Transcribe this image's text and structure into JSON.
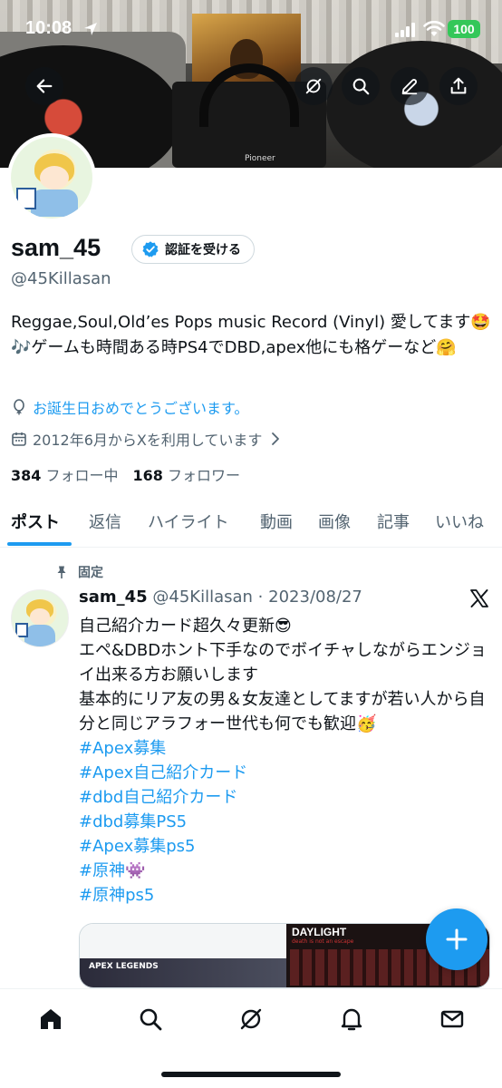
{
  "status_bar": {
    "time": "10:08",
    "battery": "100"
  },
  "banner": {
    "mixer_brand": "Pioneer"
  },
  "header_buttons": {
    "back": "arrow-left-icon",
    "grok": "grok-icon",
    "search": "search-icon",
    "edit": "edit-icon",
    "share": "share-icon"
  },
  "profile": {
    "display_name": "sam_45",
    "verify_label": "認証を受ける",
    "handle": "@45Killasan",
    "bio": "Reggae,Soul,Old’es Pops music Record (Vinyl) 愛してます🤩🎶ゲームも時間ある時PS4でDBD,apex他にも格ゲーなど🤗",
    "birthday_text": "お誕生日おめでとうございます。",
    "joined_text": "2012年6月からXを利用しています",
    "following_count": "384",
    "following_label": "フォロー中",
    "followers_count": "168",
    "followers_label": "フォロワー"
  },
  "tabs": [
    {
      "label": "ポスト",
      "active": true
    },
    {
      "label": "返信"
    },
    {
      "label": "ハイライト"
    },
    {
      "label": "動画"
    },
    {
      "label": "画像"
    },
    {
      "label": "記事"
    },
    {
      "label": "いいね"
    }
  ],
  "post": {
    "pinned_label": "固定",
    "name": "sam_45",
    "meta": "@45Killasan · 2023/08/27",
    "lines": [
      "自己紹介カード超久々更新😎",
      "エペ&DBDホント下手なのでボイチャしながらエンジョイ出来る方お願いします",
      "基本的にリア友の男＆女友達としてますが若い人から自分と同じアラフォー世代も何でも歓迎🥳"
    ],
    "hashtags": [
      "#Apex募集",
      "#Apex自己紹介カード",
      "#dbd自己紹介カード",
      "#dbd募集PS5",
      "#Apex募集ps5",
      "#原神👾",
      "#原神ps5"
    ],
    "media": {
      "left_caption": "APEX LEGENDS",
      "right_title": "DAYLIGHT",
      "right_subtitle": "death is not an escape"
    }
  },
  "bottom_nav": [
    "home-icon",
    "search-icon",
    "grok-icon",
    "notifications-icon",
    "messages-icon"
  ],
  "colors": {
    "accent": "#1d9bf0",
    "text_primary": "#0f1419",
    "text_secondary": "#536471",
    "battery": "#34c759"
  }
}
